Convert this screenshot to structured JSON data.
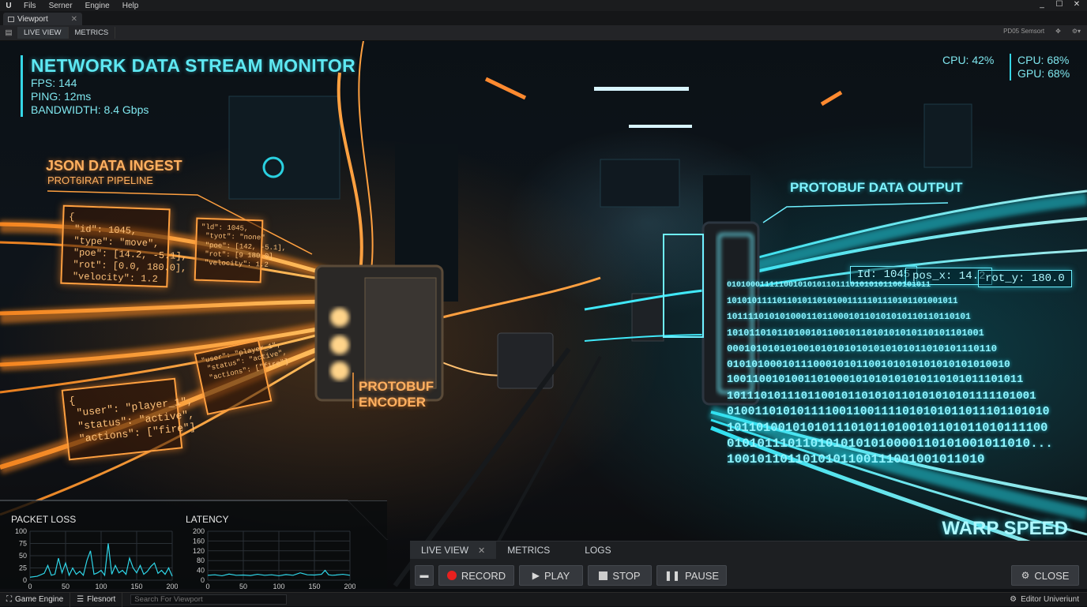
{
  "menubar": {
    "logo": "U",
    "items": [
      "Fils",
      "Serner",
      "Engine",
      "Help"
    ],
    "win": [
      "_",
      "☐",
      "✕"
    ]
  },
  "doc_tab": {
    "label": "Viewport",
    "close": "✕"
  },
  "viewport_toolbar": {
    "tabs": [
      "LIVE VIEW",
      "METRICS"
    ],
    "right_text": "PD05 Semsort"
  },
  "hud": {
    "title": "NETWORK DATA STREAM MONITOR",
    "fps": "FPS: 144",
    "ping": "PING: 12ms",
    "bandwidth": "BANDWIDTH: 8.4 Gbps",
    "cpu_left": "CPU: 42%",
    "cpu_right": "CPU: 68%",
    "gpu_right": "GPU: 68%"
  },
  "scene": {
    "json_ingest": "JSON DATA INGEST",
    "pipeline": "PROT6IRAT PIPELINE",
    "encoder_1": "PROTOBUF",
    "encoder_2": "ENCODER",
    "output": "PROTOBUF DATA OUTPUT",
    "card1": "{\n \"id\": 1045,\n \"type\": \"move\",\n \"poe\": [14.2, -5.1],\n \"rot\": [0.0, 180.0],\n \"velocity\": 1.2",
    "card2": "\"ld\": 1045,\n \"tyot\": \"none\"\n \"poe\": [142, -5.1],\n \"rot\": [9 180.0]\n \"velocity\": 1.2",
    "card3": "{\n \"user\": \"player_1\",\n \"status\": \"active\",\n \"actions\": [\"fire\"]",
    "card4": "\"user\": \"player_1\",\n \"status\": \"active\",\n \"actions\": [\"fire\"]",
    "out1": "Id: 1045",
    "out2": "pos_x: 14.2",
    "out3": "rot_y: 180.0",
    "binary": [
      "0101000111110010101011011101010101100101011",
      "1010101111011010110101001111101110101101001011",
      "1011110101010001101100010110101010110110110101",
      "1010110101101001011001011010101010110101101001",
      "0001010101010010101010101010101011010101110110",
      "0101010001011100010101100101010101010101010010",
      "1001100101001101000101010101010110101011101011",
      "1011101011101100101101010110101010101111101001",
      "0100110101011110011001111010101011011101101010",
      "10110100101010111010110100101101011010111100",
      "0101011101101010101010000110101001011010...",
      "1001011011010101100111001001011010"
    ],
    "warp": "WARP SPEED"
  },
  "charts": {
    "packet_loss": {
      "title": "PACKET LOSS",
      "yticks": [
        "100",
        "75",
        "50",
        "25",
        "0"
      ],
      "xticks": [
        "0",
        "50",
        "100",
        "150",
        "200"
      ]
    },
    "latency": {
      "title": "LATENCY",
      "yticks": [
        "200",
        "160",
        "120",
        "80",
        "40",
        "0"
      ],
      "xticks": [
        "0",
        "50",
        "100",
        "150",
        "200"
      ]
    }
  },
  "chart_data": [
    {
      "type": "line",
      "title": "PACKET LOSS",
      "xlim": [
        0,
        200
      ],
      "ylim": [
        0,
        100
      ],
      "x": [
        0,
        10,
        20,
        25,
        30,
        35,
        40,
        45,
        50,
        55,
        60,
        65,
        70,
        75,
        80,
        85,
        90,
        95,
        100,
        105,
        110,
        115,
        120,
        125,
        130,
        135,
        140,
        145,
        150,
        155,
        160,
        165,
        170,
        175,
        180,
        185,
        190,
        195,
        200
      ],
      "y": [
        6,
        8,
        14,
        30,
        10,
        12,
        45,
        15,
        35,
        10,
        25,
        12,
        18,
        10,
        40,
        60,
        12,
        15,
        20,
        10,
        75,
        12,
        30,
        15,
        20,
        12,
        45,
        25,
        15,
        30,
        12,
        18,
        28,
        35,
        14,
        20,
        12,
        25,
        8
      ]
    },
    {
      "type": "line",
      "title": "LATENCY",
      "xlim": [
        0,
        200
      ],
      "ylim": [
        0,
        200
      ],
      "x": [
        0,
        10,
        20,
        30,
        40,
        50,
        60,
        70,
        80,
        90,
        100,
        110,
        120,
        130,
        140,
        150,
        160,
        165,
        170,
        175,
        180,
        190,
        200
      ],
      "y": [
        20,
        22,
        18,
        25,
        20,
        21,
        19,
        24,
        20,
        22,
        18,
        23,
        20,
        30,
        22,
        21,
        24,
        40,
        22,
        20,
        21,
        24,
        20
      ]
    }
  ],
  "controls": {
    "tabs": [
      "LIVE VIEW",
      "METRICS",
      "LOGS"
    ],
    "tab_close": "✕",
    "record": "RECORD",
    "play": "PLAY",
    "stop": "STOP",
    "pause": "PAUSE",
    "close": "CLOSE"
  },
  "status": {
    "game_engine": "Game Engine",
    "flesnort": "Flesnort",
    "search_placeholder": "Search For Viewport",
    "editor": "Editor Univeriunt"
  }
}
